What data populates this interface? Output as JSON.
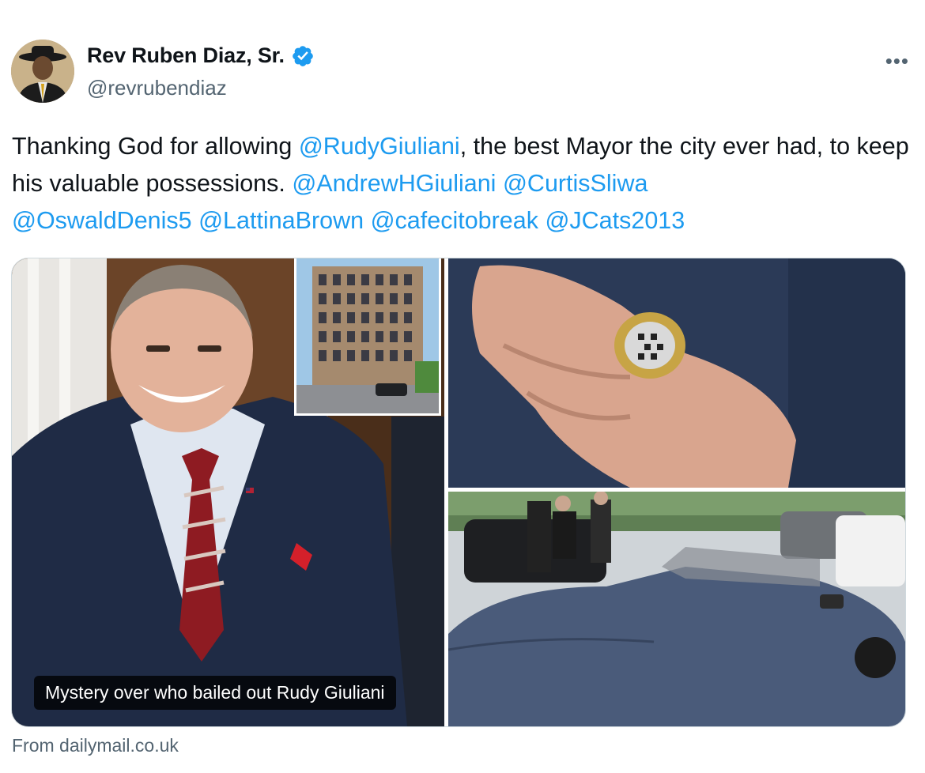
{
  "author": {
    "display_name": "Rev Ruben Diaz, Sr.",
    "handle": "@revrubendiaz",
    "verified_icon": "verified-badge-icon",
    "avatar_icon": "avatar-photo"
  },
  "more_label": "•••",
  "tweet": {
    "text_1": "Thanking God for allowing ",
    "mention_1": "@RudyGiuliani",
    "text_2": ", the best Mayor the city ever had, to keep his valuable possessions. ",
    "mention_2": "@AndrewHGiuliani",
    "mention_3": "@CurtisSliwa",
    "mention_4": "@OswaldDenis5",
    "mention_5": "@LattinaBrown",
    "mention_6": "@cafecitobreak",
    "mention_7": "@JCats2013"
  },
  "card": {
    "caption": "Mystery over who bailed out Rudy Giuliani",
    "source": "From dailymail.co.uk"
  },
  "colors": {
    "accent": "#1d9bf0",
    "secondary_text": "#536471",
    "border": "#cfd9de"
  }
}
